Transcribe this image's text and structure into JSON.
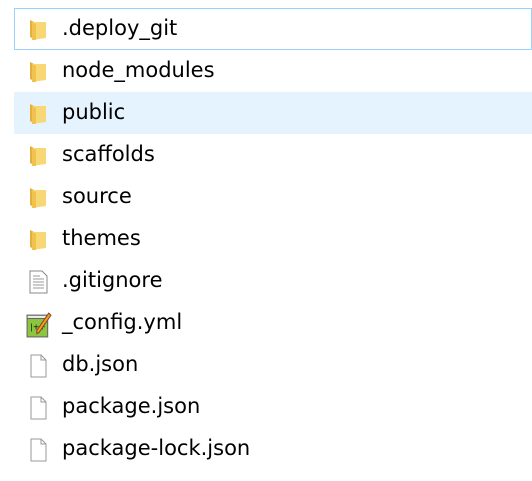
{
  "items": [
    {
      "name": ".deploy_git",
      "type": "folder"
    },
    {
      "name": "node_modules",
      "type": "folder"
    },
    {
      "name": "public",
      "type": "folder"
    },
    {
      "name": "scaffolds",
      "type": "folder"
    },
    {
      "name": "source",
      "type": "folder"
    },
    {
      "name": "themes",
      "type": "folder"
    },
    {
      "name": ".gitignore",
      "type": "text-file"
    },
    {
      "name": "_config.yml",
      "type": "notepadpp-file"
    },
    {
      "name": "db.json",
      "type": "blank-file"
    },
    {
      "name": "package.json",
      "type": "blank-file"
    },
    {
      "name": "package-lock.json",
      "type": "blank-file"
    }
  ],
  "colors": {
    "hover": "#e5f3ff",
    "focus_border": "#99d1ff",
    "folder": "#f3cd5f"
  }
}
